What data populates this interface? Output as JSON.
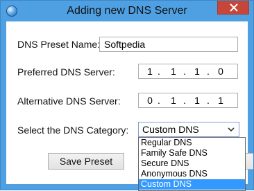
{
  "window": {
    "title": "Adding new DNS Server",
    "close_glyph": "✕"
  },
  "form": {
    "preset_label": "DNS Preset Name:",
    "preset_value": "Softpedia",
    "preferred_label": "Preferred DNS Server:",
    "preferred_octets": [
      "1",
      "1",
      "1",
      "0"
    ],
    "preferred_sep": ".",
    "alternative_label": "Alternative DNS Server:",
    "alternative_octets": [
      "0",
      "1",
      "1",
      "1"
    ],
    "alternative_sep": ".",
    "category_label": "Select the DNS Category:",
    "category_selected": "Custom DNS"
  },
  "dropdown": {
    "options": [
      "Regular DNS",
      "Family Safe DNS",
      "Secure DNS",
      "Anonymous DNS",
      "Custom DNS"
    ],
    "selected_index": 4
  },
  "buttons": {
    "save_label": "Save Preset"
  },
  "icons": {
    "app": "globe-icon",
    "close": "close-icon",
    "chevron": "chevron-down-icon"
  },
  "colors": {
    "frame": "#4fa0e3",
    "close": "#c7463a",
    "selection": "#3399ff"
  }
}
